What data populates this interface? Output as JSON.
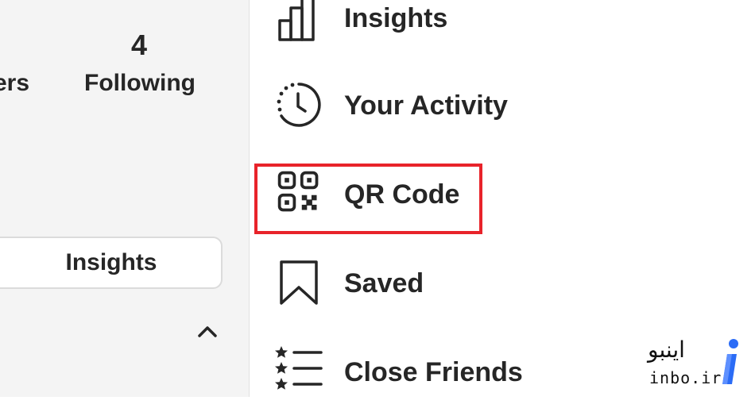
{
  "profile_stats": {
    "followers_label_partial": "ers",
    "following_count": "4",
    "following_label": "Following"
  },
  "left_panel": {
    "insights_button_label": "Insights"
  },
  "menu": {
    "items": [
      {
        "label": "Insights",
        "icon": "bar-chart-icon"
      },
      {
        "label": "Your Activity",
        "icon": "activity-clock-icon"
      },
      {
        "label": "QR Code",
        "icon": "qr-code-icon",
        "highlighted": true
      },
      {
        "label": "Saved",
        "icon": "bookmark-icon"
      },
      {
        "label": "Close Friends",
        "icon": "close-friends-list-icon"
      }
    ]
  },
  "watermark": {
    "brand_fa": "اینبو",
    "brand_en": "inbo.ir"
  },
  "colors": {
    "highlight": "#e8232a",
    "text": "#262626",
    "panel_bg": "#f4f4f4",
    "logo_blue": "#2b6cf6"
  }
}
